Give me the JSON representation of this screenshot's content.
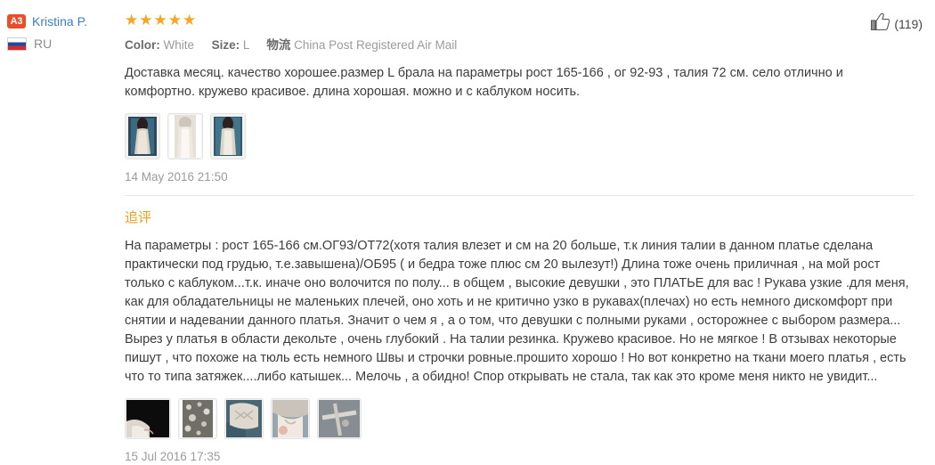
{
  "review": {
    "author": {
      "level_badge": "A3",
      "name": "Kristina P.",
      "country_code": "RU",
      "flag_icon": "flag-ru-icon"
    },
    "rating": {
      "stars_display": "★★★★★",
      "value": 5,
      "max": 5,
      "color": "#f5a623"
    },
    "attributes": {
      "color_label": "Color:",
      "color_value": "White",
      "size_label": "Size:",
      "size_value": "L",
      "logistics_label": "物流",
      "logistics_value": "China Post Registered Air Mail"
    },
    "text": "Доставка месяц. качество хорошее.размер L брала на параметры рост 165-166 , ог 92-93 , талия 72 см. село отлично и комфортно. кружево красивое. длина хорошая. можно и с каблуком носить.",
    "thumbnails": [
      {
        "name": "review-photo-1"
      },
      {
        "name": "review-photo-2"
      },
      {
        "name": "review-photo-3"
      }
    ],
    "date": "14 May 2016 21:50",
    "helpful": {
      "icon": "thumbs-up-icon",
      "count_display": "(119)",
      "count": 119
    }
  },
  "followup": {
    "title": "追评",
    "title_color": "#e8a21c",
    "text": "На параметры : рост 165-166 см.ОГ93/ОТ72(хотя талия влезет и см на 20 больше, т.к линия талии в данном платье сделана практически под грудью, т.е.завышена)/ОБ95 ( и бедра тоже плюс см 20 вылезут!) Длина тоже очень приличная , на мой рост только с каблуком...т.к. иначе оно волочится по полу... в общем , высокие девушки , это ПЛАТЬЕ для вас ! Рукава узкие .для меня, как для обладательницы не маленьких плечей, оно хоть и не критично узко в рукавах(плечах) но есть немного дискомфорт при снятии и надевании данного платья. Значит о чем я , а о том, что девушки с полными руками , осторожнее с выбором размера... Вырез у платья в области декольте , очень глубокий . На талии резинка. Кружево красивое. Но не мягкое ! В отзывах некоторые пишут , что похоже на тюль есть немного Швы и строчки ровные.прошито хорошо ! Но вот конкретно на ткани моего платья , есть что то типа затяжек....либо катышек... Мелочь , а обидно! Спор открывать не стала, так как это кроме меня никто не увидит...",
    "thumbnails": [
      {
        "name": "followup-photo-1"
      },
      {
        "name": "followup-photo-2"
      },
      {
        "name": "followup-photo-3"
      },
      {
        "name": "followup-photo-4"
      },
      {
        "name": "followup-photo-5"
      }
    ],
    "date": "15 Jul 2016 17:35"
  }
}
